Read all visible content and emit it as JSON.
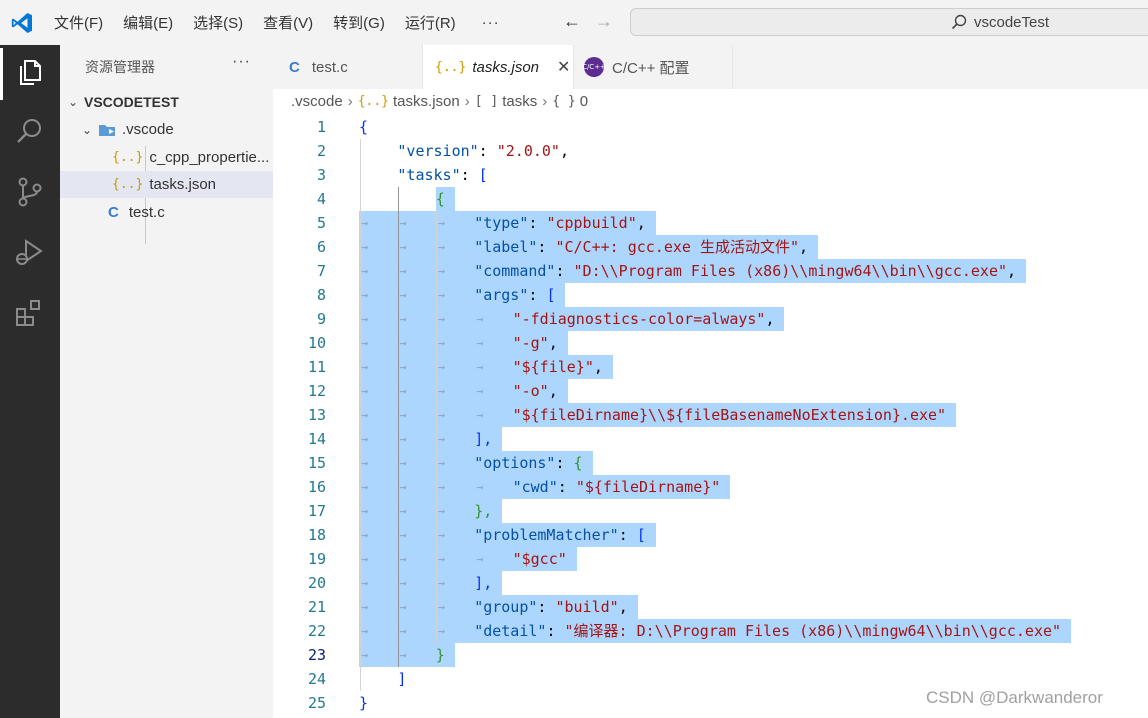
{
  "titlebar": {
    "menu": [
      "文件(F)",
      "编辑(E)",
      "选择(S)",
      "查看(V)",
      "转到(G)",
      "运行(R)"
    ],
    "more": "···",
    "back_icon": "←",
    "forward_icon": "→",
    "search_text": "vscodeTest"
  },
  "activity_bar": {
    "items": [
      "explorer-icon",
      "search-icon",
      "source-control-icon",
      "run-debug-icon",
      "extensions-icon"
    ]
  },
  "sidebar": {
    "title": "资源管理器",
    "more": "···",
    "root": "VSCODETEST",
    "folder": ".vscode",
    "files": [
      {
        "icon": "{..}",
        "name": "c_cpp_propertie..."
      },
      {
        "icon": "{..}",
        "name": "tasks.json"
      }
    ],
    "root_file": {
      "icon": "C",
      "name": "test.c"
    }
  },
  "tabs": [
    {
      "icon": "C",
      "label": "test.c"
    },
    {
      "icon": "{..}",
      "label": "tasks.json",
      "close": "✕"
    },
    {
      "icon": "C/C++",
      "label": "C/C++ 配置"
    }
  ],
  "breadcrumb": [
    {
      "icon": "",
      "text": ".vscode"
    },
    {
      "icon": "{..}",
      "text": "tasks.json"
    },
    {
      "icon": "[ ]",
      "text": "tasks"
    },
    {
      "icon": "{ }",
      "text": "0"
    }
  ],
  "editor": {
    "current_line": 23,
    "lines": [
      {
        "n": "1",
        "indent": 0,
        "tokens": [
          [
            "{",
            "p"
          ]
        ]
      },
      {
        "n": "2",
        "indent": 1,
        "tokens": [
          [
            "\"version\"",
            "k"
          ],
          [
            ": ",
            "p"
          ],
          [
            "\"2.0.0\"",
            "s"
          ],
          [
            ",",
            "p"
          ]
        ]
      },
      {
        "n": "3",
        "indent": 1,
        "tokens": [
          [
            "\"tasks\"",
            "k"
          ],
          [
            ": ",
            "p"
          ],
          [
            "[",
            "p"
          ]
        ]
      },
      {
        "n": "4",
        "indent": 2,
        "tokens": [
          [
            "{",
            "p"
          ]
        ]
      },
      {
        "n": "5",
        "indent": 3,
        "tokens": [
          [
            "\"type\"",
            "k"
          ],
          [
            ": ",
            "p"
          ],
          [
            "\"cppbuild\"",
            "s"
          ],
          [
            ",",
            "p"
          ]
        ]
      },
      {
        "n": "6",
        "indent": 3,
        "tokens": [
          [
            "\"label\"",
            "k"
          ],
          [
            ": ",
            "p"
          ],
          [
            "\"C/C++: gcc.exe 生成活动文件\"",
            "s"
          ],
          [
            ",",
            "p"
          ]
        ]
      },
      {
        "n": "7",
        "indent": 3,
        "tokens": [
          [
            "\"command\"",
            "k"
          ],
          [
            ": ",
            "p"
          ],
          [
            "\"D:\\\\Program Files (x86)\\\\mingw64\\\\bin\\\\gcc.exe\"",
            "s"
          ],
          [
            ",",
            "p"
          ]
        ]
      },
      {
        "n": "8",
        "indent": 3,
        "tokens": [
          [
            "\"args\"",
            "k"
          ],
          [
            ": ",
            "p"
          ],
          [
            "[",
            "p"
          ]
        ]
      },
      {
        "n": "9",
        "indent": 4,
        "tokens": [
          [
            "\"-fdiagnostics-color=always\"",
            "s"
          ],
          [
            ",",
            "p"
          ]
        ]
      },
      {
        "n": "10",
        "indent": 4,
        "tokens": [
          [
            "\"-g\"",
            "s"
          ],
          [
            ",",
            "p"
          ]
        ]
      },
      {
        "n": "11",
        "indent": 4,
        "tokens": [
          [
            "\"${file}\"",
            "s"
          ],
          [
            ",",
            "p"
          ]
        ]
      },
      {
        "n": "12",
        "indent": 4,
        "tokens": [
          [
            "\"-o\"",
            "s"
          ],
          [
            ",",
            "p"
          ]
        ]
      },
      {
        "n": "13",
        "indent": 4,
        "tokens": [
          [
            "\"${fileDirname}\\\\${fileBasenameNoExtension}.exe\"",
            "s"
          ]
        ]
      },
      {
        "n": "14",
        "indent": 3,
        "tokens": [
          [
            "],",
            "p"
          ]
        ]
      },
      {
        "n": "15",
        "indent": 3,
        "tokens": [
          [
            "\"options\"",
            "k"
          ],
          [
            ": ",
            "p"
          ],
          [
            "{",
            "p"
          ]
        ]
      },
      {
        "n": "16",
        "indent": 4,
        "tokens": [
          [
            "\"cwd\"",
            "k"
          ],
          [
            ": ",
            "p"
          ],
          [
            "\"${fileDirname}\"",
            "s"
          ]
        ]
      },
      {
        "n": "17",
        "indent": 3,
        "tokens": [
          [
            "},",
            "p"
          ]
        ]
      },
      {
        "n": "18",
        "indent": 3,
        "tokens": [
          [
            "\"problemMatcher\"",
            "k"
          ],
          [
            ": ",
            "p"
          ],
          [
            "[",
            "p"
          ]
        ]
      },
      {
        "n": "19",
        "indent": 4,
        "tokens": [
          [
            "\"$gcc\"",
            "s"
          ]
        ]
      },
      {
        "n": "20",
        "indent": 3,
        "tokens": [
          [
            "],",
            "p"
          ]
        ]
      },
      {
        "n": "21",
        "indent": 3,
        "tokens": [
          [
            "\"group\"",
            "k"
          ],
          [
            ": ",
            "p"
          ],
          [
            "\"build\"",
            "s"
          ],
          [
            ",",
            "p"
          ]
        ]
      },
      {
        "n": "22",
        "indent": 3,
        "tokens": [
          [
            "\"detail\"",
            "k"
          ],
          [
            ": ",
            "p"
          ],
          [
            "\"编译器: D:\\\\Program Files (x86)\\\\mingw64\\\\bin\\\\gcc.exe\"",
            "s"
          ]
        ]
      },
      {
        "n": "23",
        "indent": 2,
        "tokens": [
          [
            "}",
            "p"
          ]
        ]
      },
      {
        "n": "24",
        "indent": 1,
        "tokens": [
          [
            "]",
            "p"
          ]
        ]
      },
      {
        "n": "25",
        "indent": 0,
        "tokens": [
          [
            "}",
            "p"
          ]
        ]
      }
    ]
  },
  "watermark": "CSDN @Darkwanderor",
  "colors": {
    "key": "#0451a5",
    "string": "#a31515",
    "punct": "#000000",
    "array_bracket": "#0431fa",
    "selection": "#add6ff",
    "line_number": "#237893",
    "activity_bar": "#2c2c2c",
    "vscode_blue": "#0078d4"
  }
}
